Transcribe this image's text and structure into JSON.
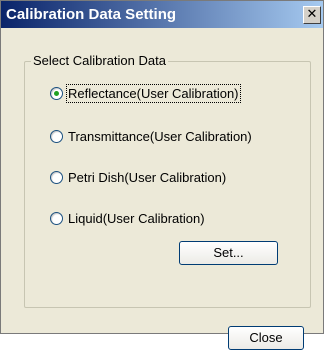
{
  "window": {
    "title": "Calibration Data Setting",
    "close_glyph": "✕"
  },
  "group": {
    "legend": "Select Calibration Data",
    "options": [
      {
        "label": "Reflectance(User Calibration)",
        "selected": true
      },
      {
        "label": "Transmittance(User Calibration)",
        "selected": false
      },
      {
        "label": "Petri Dish(User Calibration)",
        "selected": false
      },
      {
        "label": "Liquid(User Calibration)",
        "selected": false
      }
    ],
    "set_button": "Set..."
  },
  "footer": {
    "close_button": "Close"
  }
}
